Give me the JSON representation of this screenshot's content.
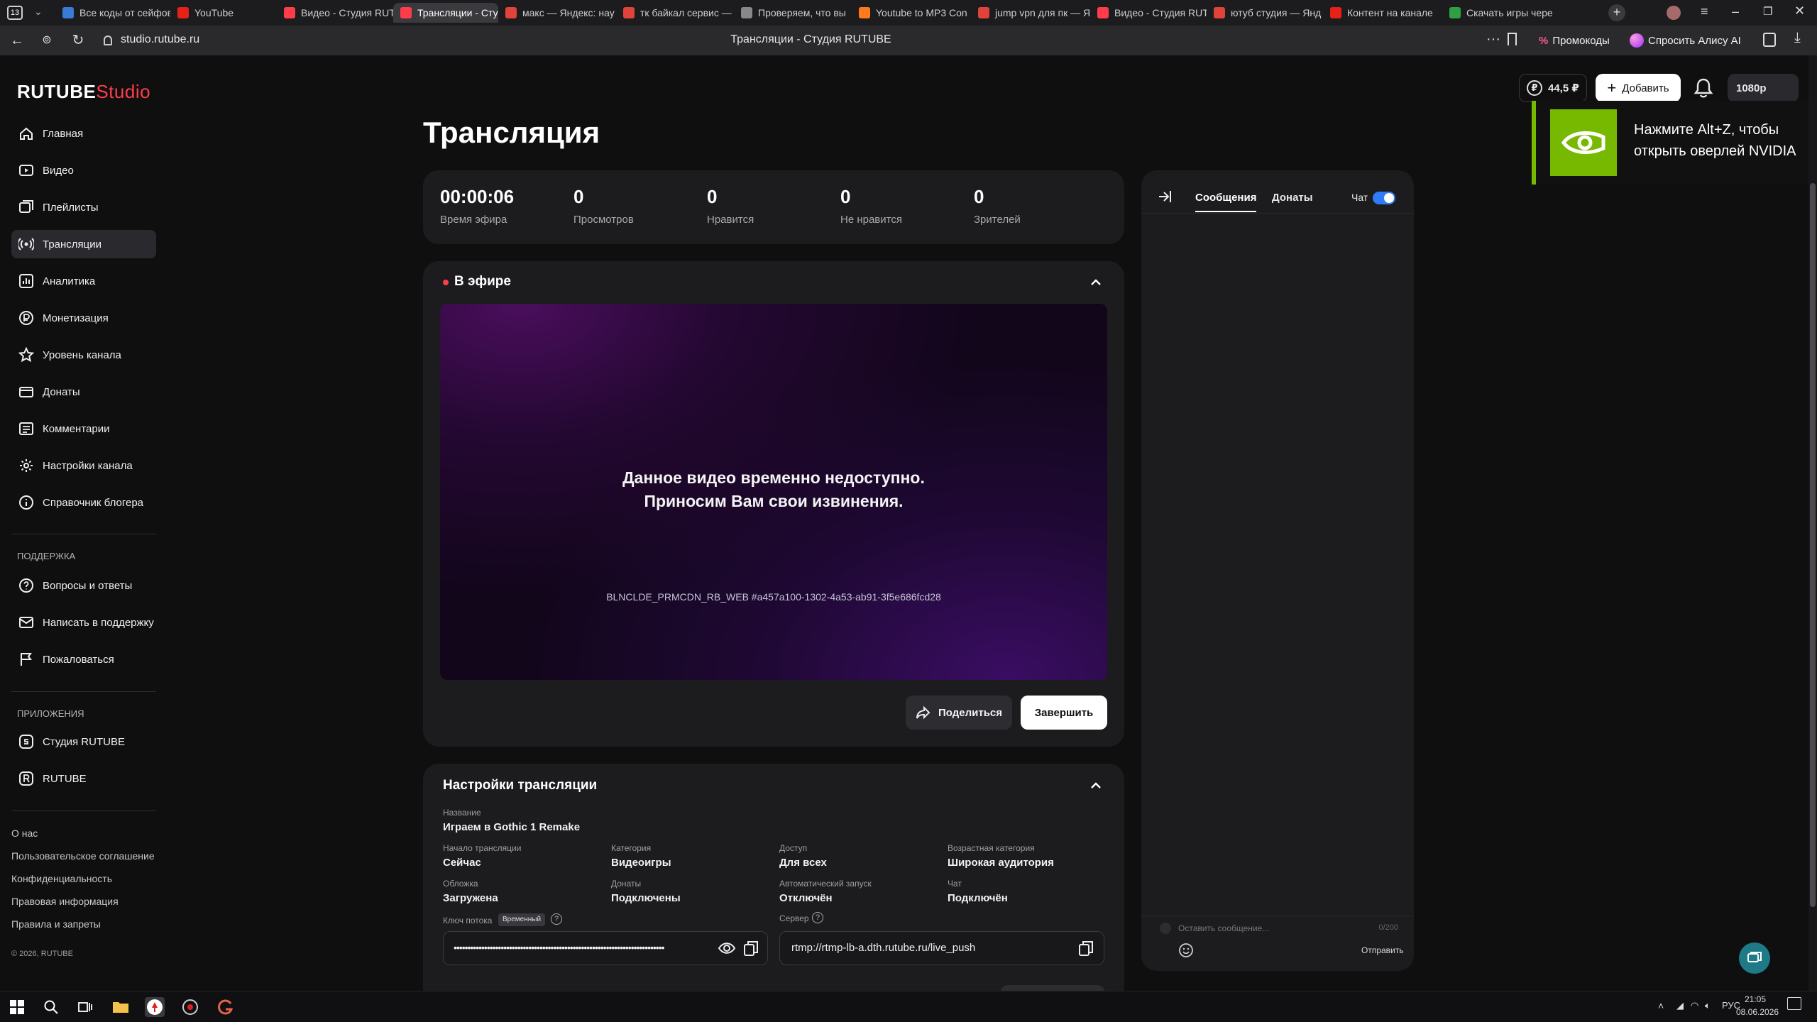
{
  "browser": {
    "tab_count": "13",
    "tabs": [
      {
        "title": "Все коды от сейфов",
        "color": "#3a7bd5"
      },
      {
        "title": "YouTube",
        "color": "#e62117"
      },
      {
        "title": "Видео - Студия RUT",
        "color": "#ff3d4a"
      },
      {
        "title": "Трансляции - Сту",
        "color": "#ff3d4a"
      },
      {
        "title": "макс — Яндекс: нау",
        "color": "#e0433a"
      },
      {
        "title": "тк байкал сервис —",
        "color": "#e0433a"
      },
      {
        "title": "Проверяем, что вы",
        "color": "#888888"
      },
      {
        "title": "Youtube to MP3 Con",
        "color": "#ff7a1a"
      },
      {
        "title": "jump vpn для пк — Я",
        "color": "#e0433a"
      },
      {
        "title": "Видео - Студия RUT",
        "color": "#ff3d4a"
      },
      {
        "title": "ютуб студия — Янд",
        "color": "#e0433a"
      },
      {
        "title": "Контент на канале",
        "color": "#e62117"
      },
      {
        "title": "Скачать игры чере",
        "color": "#2ea043"
      }
    ],
    "url": "studio.rutube.ru",
    "page_title": "Трансляции - Студия RUTUBE",
    "promo_label": "Промокоды",
    "alice_label": "Спросить Алису AI"
  },
  "header": {
    "balance": "44,5 ₽",
    "add_label": "Добавить",
    "quality": "1080p"
  },
  "overlay": {
    "text_line1": "Нажмите Alt+Z, чтобы",
    "text_line2": "открыть оверлей NVIDIA"
  },
  "sidebar": {
    "logo_main": "RUTUBE",
    "logo_studio": "Studio",
    "items": [
      {
        "label": "Главная",
        "icon": "home-icon"
      },
      {
        "label": "Видео",
        "icon": "video-icon"
      },
      {
        "label": "Плейлисты",
        "icon": "playlist-icon"
      },
      {
        "label": "Трансляции",
        "icon": "broadcast-icon"
      },
      {
        "label": "Аналитика",
        "icon": "analytics-icon"
      },
      {
        "label": "Монетизация",
        "icon": "ruble-icon"
      },
      {
        "label": "Уровень канала",
        "icon": "star-icon"
      },
      {
        "label": "Донаты",
        "icon": "donate-icon"
      },
      {
        "label": "Комментарии",
        "icon": "comments-icon"
      },
      {
        "label": "Настройки канала",
        "icon": "gear-icon"
      },
      {
        "label": "Справочник блогера",
        "icon": "info-icon"
      }
    ],
    "support_label": "ПОДДЕРЖКА",
    "support_items": [
      {
        "label": "Вопросы и ответы",
        "icon": "question-icon"
      },
      {
        "label": "Написать в поддержку",
        "icon": "mail-icon"
      },
      {
        "label": "Пожаловаться",
        "icon": "flag-icon"
      }
    ],
    "apps_label": "ПРИЛОЖЕНИЯ",
    "app_items": [
      {
        "label": "Студия RUTUBE",
        "icon": "studio-app-icon"
      },
      {
        "label": "RUTUBE",
        "icon": "rutube-app-icon"
      }
    ],
    "footer_links": [
      "О нас",
      "Пользовательское соглашение",
      "Конфиденциальность",
      "Правовая информация",
      "Правила и запреты"
    ],
    "copyright": "© 2026, RUTUBE"
  },
  "main": {
    "title": "Трансляция",
    "stats": [
      {
        "value": "00:00:06",
        "label": "Время эфира"
      },
      {
        "value": "0",
        "label": "Просмотров"
      },
      {
        "value": "0",
        "label": "Нравится"
      },
      {
        "value": "0",
        "label": "Не нравится"
      },
      {
        "value": "0",
        "label": "Зрителей"
      }
    ],
    "live": {
      "label": "В эфире",
      "unavailable_line1": "Данное видео временно недоступно.",
      "unavailable_line2": "Приносим Вам свои извинения.",
      "error_code": "BLNCLDE_PRMCDN_RB_WEB #a457a100-1302-4a53-ab91-3f5e686fcd28",
      "share_label": "Поделиться",
      "finish_label": "Завершить"
    },
    "settings": {
      "title": "Настройки трансляции",
      "name_label": "Название",
      "name_value": "Играем в Gothic 1 Remake",
      "fields": [
        {
          "label": "Начало трансляции",
          "value": "Сейчас"
        },
        {
          "label": "Категория",
          "value": "Видеоигры"
        },
        {
          "label": "Доступ",
          "value": "Для всех"
        },
        {
          "label": "Возрастная категория",
          "value": "Широкая аудитория"
        },
        {
          "label": "Обложка",
          "value": "Загружена"
        },
        {
          "label": "Донаты",
          "value": "Подключены"
        },
        {
          "label": "Автоматический запуск",
          "value": "Отключён"
        },
        {
          "label": "Чат",
          "value": "Подключён"
        }
      ],
      "key_label": "Ключ потока",
      "key_badge": "Временный",
      "key_value": "••••••••••••••••••••••••••••••••••••••••••••••••••••••••••••••••••••••••••••",
      "server_label": "Сервер",
      "server_value": "rtmp://rtmp-lb-a.dth.rutube.ru/live_push"
    }
  },
  "chat": {
    "tab_messages": "Сообщения",
    "tab_donations": "Донаты",
    "toggle_label": "Чат",
    "toggle_on": true,
    "input_placeholder": "Оставить сообщение...",
    "counter": "0/200",
    "send_label": "Отправить"
  },
  "taskbar": {
    "lang": "РУС",
    "time": "21:05",
    "date": "08.06.2026"
  },
  "colors": {
    "accent": "#ff3d4a",
    "toggle": "#2f7cf6",
    "nvidia": "#76b900",
    "live_dot": "#ff3d4a"
  }
}
